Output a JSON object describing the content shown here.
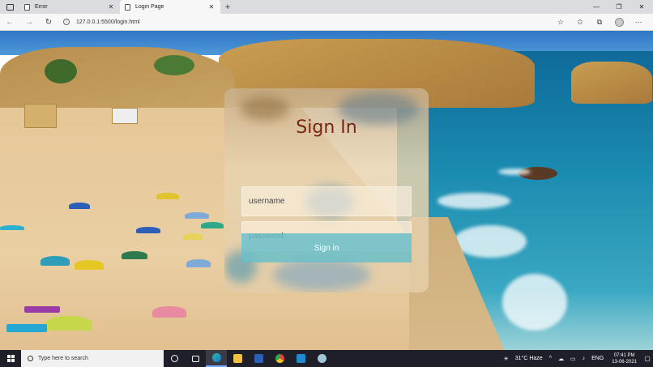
{
  "browser": {
    "tabs": [
      {
        "title": "Error",
        "active": false
      },
      {
        "title": "Login Page",
        "active": true
      }
    ],
    "url": "127.0.0.1:5500/login.html"
  },
  "login": {
    "title": "Sign In",
    "username_placeholder": "username",
    "password_placeholder": "password",
    "submit_label": "Sign in"
  },
  "taskbar": {
    "search_placeholder": "Type here to search",
    "weather": "31°C  Haze",
    "language": "ENG",
    "time": "07:41 PM",
    "date": "13-06-2021"
  },
  "icons": {
    "tab_actions": "tab-actions-icon",
    "back": "back-arrow-icon",
    "forward": "forward-arrow-icon",
    "reload": "reload-icon",
    "info": "info-icon",
    "favorites_add": "star-plus-icon",
    "favorites": "favorites-icon",
    "collections": "collections-icon",
    "profile": "profile-icon",
    "more": "more-icon"
  },
  "colors": {
    "title_color": "#7a2416",
    "button_color": "#6abec8",
    "taskbar": "#1e1f29"
  }
}
